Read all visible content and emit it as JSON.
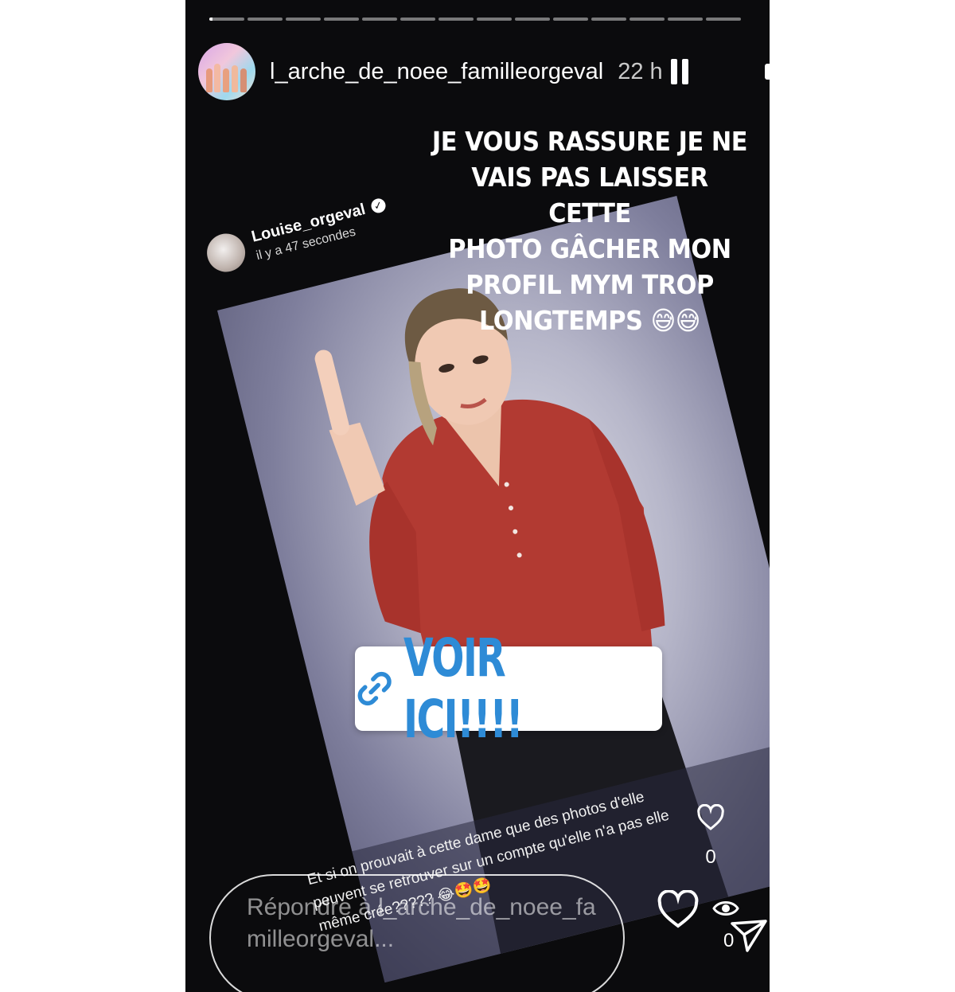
{
  "story": {
    "account_username": "l_arche_de_noee_familleorgeval",
    "time_ago": "22 h",
    "progress_segments": 14,
    "current_segment": 0,
    "current_segment_progress": 0.1,
    "caption_lines": [
      "JE VOUS RASSURE JE NE",
      "VAIS PAS LAISSER CETTE",
      "PHOTO GÂCHER MON",
      "PROFIL MYM TROP",
      "LONGTEMPS 😅😅"
    ]
  },
  "repost": {
    "username": "Louise_orgeval",
    "timestamp": "il y a 47 secondes",
    "comment": "Et si on prouvait à cette dame que des photos d'elle peuvent se retrouver sur un compte qu'elle n'a pas elle même crée????? 😂🤩🤩",
    "like_count": "0"
  },
  "link_sticker": {
    "label": "VOIR ICI!!!!"
  },
  "reply": {
    "placeholder": "Répondre à l_arche_de_noee_familleorgeval..."
  },
  "viewer_count": "0",
  "colors": {
    "background": "#0b0b0d",
    "link": "#2e8bd6",
    "shirt": "#b23a32"
  }
}
